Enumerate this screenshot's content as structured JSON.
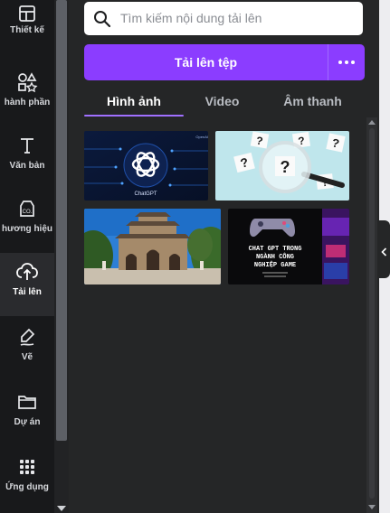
{
  "rail": {
    "items": [
      {
        "label": "Thiết kế",
        "icon": "template-icon"
      },
      {
        "label": "hành phần",
        "icon": "elements-icon"
      },
      {
        "label": "Văn bản",
        "icon": "text-icon"
      },
      {
        "label": "hương hiệu",
        "icon": "brand-icon"
      },
      {
        "label": "Tải lên",
        "icon": "upload-cloud-icon",
        "active": true
      },
      {
        "label": "Vẽ",
        "icon": "draw-icon"
      },
      {
        "label": "Dự án",
        "icon": "folder-icon"
      },
      {
        "label": "Ứng dụng",
        "icon": "apps-icon"
      }
    ]
  },
  "search": {
    "placeholder": "Tìm kiếm nội dung tải lên"
  },
  "upload": {
    "label": "Tải lên tệp",
    "more_icon": "more-dots-icon"
  },
  "tabs": [
    {
      "label": "Hình ảnh",
      "active": true
    },
    {
      "label": "Video"
    },
    {
      "label": "Âm thanh"
    }
  ],
  "thumbnails": [
    {
      "name": "chatgpt-logo",
      "caption": "ChatGPT",
      "corner": "OpenAI"
    },
    {
      "name": "question-marks-magnifier",
      "marks": "?"
    },
    {
      "name": "hue-citadel-gate"
    },
    {
      "name": "chat-gpt-gaming",
      "line1": "CHAT GPT TRONG",
      "line2": "NGÀNH CÔNG",
      "line3": "NGHIỆP GAME"
    }
  ],
  "colors": {
    "accent": "#8b3dff",
    "panel": "#252627",
    "rail": "#18191b"
  }
}
